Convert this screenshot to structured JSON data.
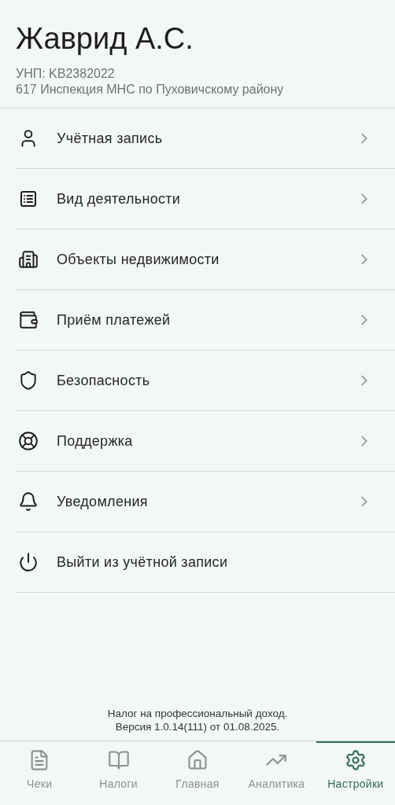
{
  "profile": {
    "name": "Жаврид А.С.",
    "unp": "УНП: KB2382022",
    "inspection": "617 Инспекция МНС по Пуховичскому району"
  },
  "menu": [
    {
      "label": "Учётная запись",
      "kind": "link"
    },
    {
      "label": "Вид деятельности",
      "kind": "link"
    },
    {
      "label": "Объекты недвижимости",
      "kind": "link"
    },
    {
      "label": "Приём платежей",
      "kind": "link"
    },
    {
      "label": "Безопасность",
      "kind": "link"
    },
    {
      "label": "Поддержка",
      "kind": "link"
    },
    {
      "label": "Уведомления",
      "kind": "link"
    },
    {
      "label": "Выйти из учётной записи",
      "kind": "action"
    }
  ],
  "footer": [
    "Налог на профессиональный доход.",
    "Версия 1.0.14(111) от 01.08.2025."
  ],
  "tabs": [
    {
      "label": "Чеки",
      "selected": false
    },
    {
      "label": "Налоги",
      "selected": false
    },
    {
      "label": "Главная",
      "selected": false
    },
    {
      "label": "Аналитика",
      "selected": false
    },
    {
      "label": "Настройки",
      "selected": true
    }
  ]
}
